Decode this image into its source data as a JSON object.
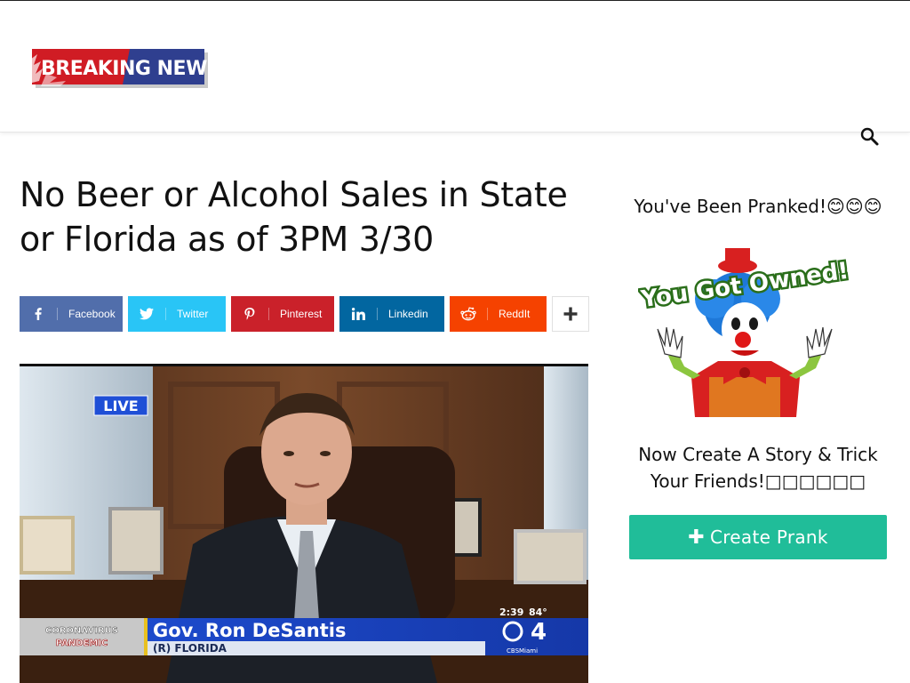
{
  "header": {
    "logo_text": "BREAKING NEWS",
    "search_icon": "search-icon"
  },
  "article": {
    "title": "No Beer or Alcohol Sales in State or Florida as of 3PM 3/30",
    "share": {
      "facebook": "Facebook",
      "twitter": "Twitter",
      "pinterest": "Pinterest",
      "linkedin": "Linkedin",
      "reddit": "ReddIt",
      "more_icon": "plus-icon"
    },
    "video": {
      "live_badge": "LIVE",
      "lower_third_tag_1": "CORONAVIRUS",
      "lower_third_tag_2": "PANDEMIC",
      "name": "Gov. Ron DeSantis",
      "affiliation": "(R) FLORIDA",
      "time": "2:39",
      "temp": "84°",
      "channel": "4",
      "channel_sub": "CBSMiami"
    }
  },
  "sidebar": {
    "pranked_title": "You've Been Pranked!😊😊😊",
    "banner_text": "You Got Owned!",
    "cta_line1": "Now Create A Story & Trick",
    "cta_line2": "Your Friends!□□□□□□",
    "create_button": "Create Prank"
  },
  "colors": {
    "facebook": "#516eab",
    "twitter": "#29c5f6",
    "pinterest": "#ca212a",
    "linkedin": "#0266a0",
    "reddit": "#f54200",
    "create_button": "#20bd99"
  }
}
